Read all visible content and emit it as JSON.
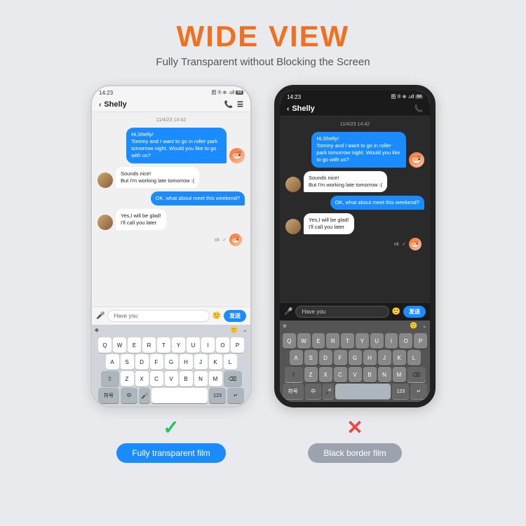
{
  "header": {
    "title": "WIDE VIEW",
    "subtitle": "Fully Transparent without Blocking the Screen"
  },
  "phone_left": {
    "status_time": "14:23",
    "status_icons": "图 ® ⊕ .ull 84",
    "chat_name": "Shelly",
    "date_label": "11/4/23 14:42",
    "messages": [
      {
        "type": "sent",
        "text": "Hi,Shelly!\nTommy and I want to go in roller park tomorrow night. Would you like to go with us?"
      },
      {
        "type": "received",
        "text": "Sounds nice!\nBut I'm working late tomorrow :("
      },
      {
        "type": "sent",
        "text": "OK, what about meet this weekend?"
      },
      {
        "type": "received",
        "text": "Yes,I will be glad!\nI'll call you later"
      }
    ],
    "input_placeholder": "Have you",
    "send_label": "发送",
    "keyboard_rows": [
      [
        "Q",
        "W",
        "E",
        "R",
        "T",
        "Y",
        "U",
        "I",
        "O",
        "P"
      ],
      [
        "A",
        "S",
        "D",
        "F",
        "G",
        "H",
        "J",
        "K",
        "L"
      ],
      [
        "Z",
        "X",
        "C",
        "V",
        "B",
        "N",
        "M"
      ]
    ],
    "bottom_keys": [
      "符号",
      "中",
      "⬆",
      "123",
      "↵"
    ]
  },
  "phone_right": {
    "status_time": "14:23",
    "status_icons": "图 ® ⊕ .ull 84",
    "chat_name": "Shelly",
    "date_label": "11/4/23 14:42",
    "messages": [
      {
        "type": "sent",
        "text": "Hi,Shelly!\nTommy and I want to go in roller park tomorrow night. Would you like to go with us?"
      },
      {
        "type": "received",
        "text": "Sounds nice!\nBut I'm working late tomorrow :("
      },
      {
        "type": "sent",
        "text": "OK, what about meet this weekend?"
      },
      {
        "type": "received",
        "text": "Yes,I will be glad!\nI'll call you later"
      }
    ],
    "input_placeholder": "Have you",
    "send_label": "发送",
    "keyboard_rows": [
      [
        "Q",
        "W",
        "E",
        "R",
        "T",
        "Y",
        "U",
        "I",
        "O",
        "P"
      ],
      [
        "A",
        "S",
        "D",
        "F",
        "G",
        "H",
        "J",
        "K",
        "L"
      ],
      [
        "Z",
        "X",
        "C",
        "V",
        "B",
        "N",
        "M"
      ]
    ],
    "bottom_keys": [
      "符号",
      "中",
      "⬆",
      "123",
      "↵"
    ]
  },
  "label_left": {
    "check": "✓",
    "text": "Fully transparent film"
  },
  "label_right": {
    "cross": "✕",
    "text": "Black border film"
  },
  "colors": {
    "title": "#f07020",
    "green": "#22c55e",
    "red": "#ef4444",
    "blue_badge": "#1a8cff",
    "gray_badge": "#9ca3af"
  }
}
